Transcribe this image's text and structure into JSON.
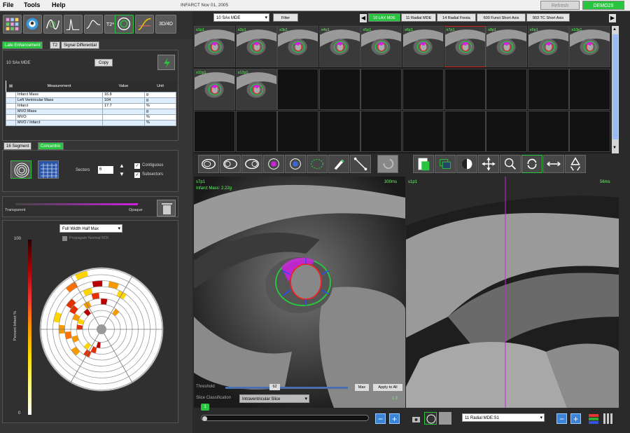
{
  "menu": {
    "file": "File",
    "tools": "Tools",
    "help": "Help"
  },
  "app_title": "INFARCT   Nov 01, 2005",
  "top_buttons": {
    "refresh": "Refresh",
    "demo": "DEMO29"
  },
  "toolbar": {
    "t2_label": "T2*",
    "threed_label": "3D/4D"
  },
  "left_tabs": {
    "late": "Late Enhancement",
    "t2": "T2",
    "signal": "Signal Differential"
  },
  "series_label": "10 SAx MDE",
  "copy_label": "Copy",
  "table": {
    "headers": [
      "Measurement",
      "Value",
      "Unit"
    ],
    "rows": [
      {
        "m": "Infarct Mass",
        "v": "16.8",
        "u": "g"
      },
      {
        "m": "Left Ventricular Mass",
        "v": "104",
        "u": "g"
      },
      {
        "m": "Infarct",
        "v": "17.7",
        "u": "%"
      },
      {
        "m": "MVO Mass",
        "v": "",
        "u": "g"
      },
      {
        "m": "MVO",
        "v": "",
        "u": "%"
      },
      {
        "m": "MVO / Infarct",
        "v": "",
        "u": "%"
      }
    ]
  },
  "segment_tabs": {
    "seg16": "16 Segment",
    "concentric": "Concentric"
  },
  "sectors": {
    "label": "Sectors",
    "value": "6",
    "contiguous": "Contiguous",
    "subsectors": "Subsectors"
  },
  "slider": {
    "left": "Transparent",
    "right": "Opaque"
  },
  "bullseye": {
    "mode": "Full Width Half Max",
    "propagate": "Propagate Normal ROI",
    "max": "100",
    "min": "0",
    "axis": "Percent Infarct %"
  },
  "series_bar": {
    "select": "10 SAx MDE",
    "filter": "Filter",
    "tabs": [
      "10 LAX MDE",
      "11 Radial MDE",
      "14 Radial Fiesta",
      "600 Funct Short Axis",
      "903 TC Short Axis"
    ]
  },
  "thumbs": [
    "s1p1",
    "s2p1",
    "s3p1",
    "s4p1",
    "s5p1",
    "s6p1",
    "s7p1",
    "s8p1",
    "s9p1",
    "s10p1",
    "s11p1",
    "s12p1"
  ],
  "viewL": {
    "slice": "s7p1",
    "infarct": "Infarct Mass: 2.22g",
    "time": "300ms",
    "threshold": "Threshold",
    "thr_value": "62",
    "max": "Max",
    "apply": "Apply to All",
    "classification": "Slice Classification",
    "class_value": "Intraventricular Slice",
    "zoom": "1.0"
  },
  "viewR": {
    "slice": "s1p1",
    "time": "56ms"
  },
  "bottom": {
    "badge": "1",
    "series_select": "11 Radial MDE:S1"
  },
  "colors": {
    "accent": "#29c440",
    "blue": "#3b84d8",
    "magenta": "#d020e0"
  }
}
